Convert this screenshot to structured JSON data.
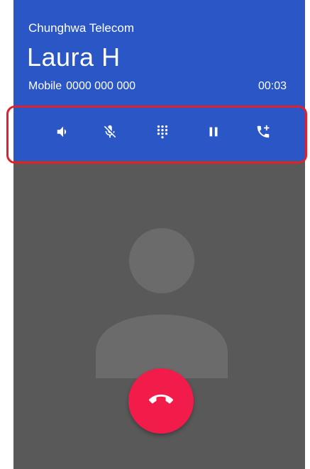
{
  "call": {
    "carrier": "Chunghwa Telecom",
    "contact_name": "Laura H",
    "line_type": "Mobile",
    "phone_number": "0000 000 000",
    "duration": "00:03"
  },
  "actions": [
    {
      "name": "speaker",
      "icon": "speaker-icon"
    },
    {
      "name": "mute",
      "icon": "microphone-off-icon"
    },
    {
      "name": "keypad",
      "icon": "dialpad-icon"
    },
    {
      "name": "hold",
      "icon": "pause-icon"
    },
    {
      "name": "add-call",
      "icon": "add-call-icon"
    }
  ],
  "end_call": {
    "icon": "end-call-icon"
  },
  "colors": {
    "header": "#2a56c6",
    "background": "#595959",
    "end_call": "#f21c4b",
    "highlight": "#e0202a",
    "icon": "#ffffff"
  }
}
